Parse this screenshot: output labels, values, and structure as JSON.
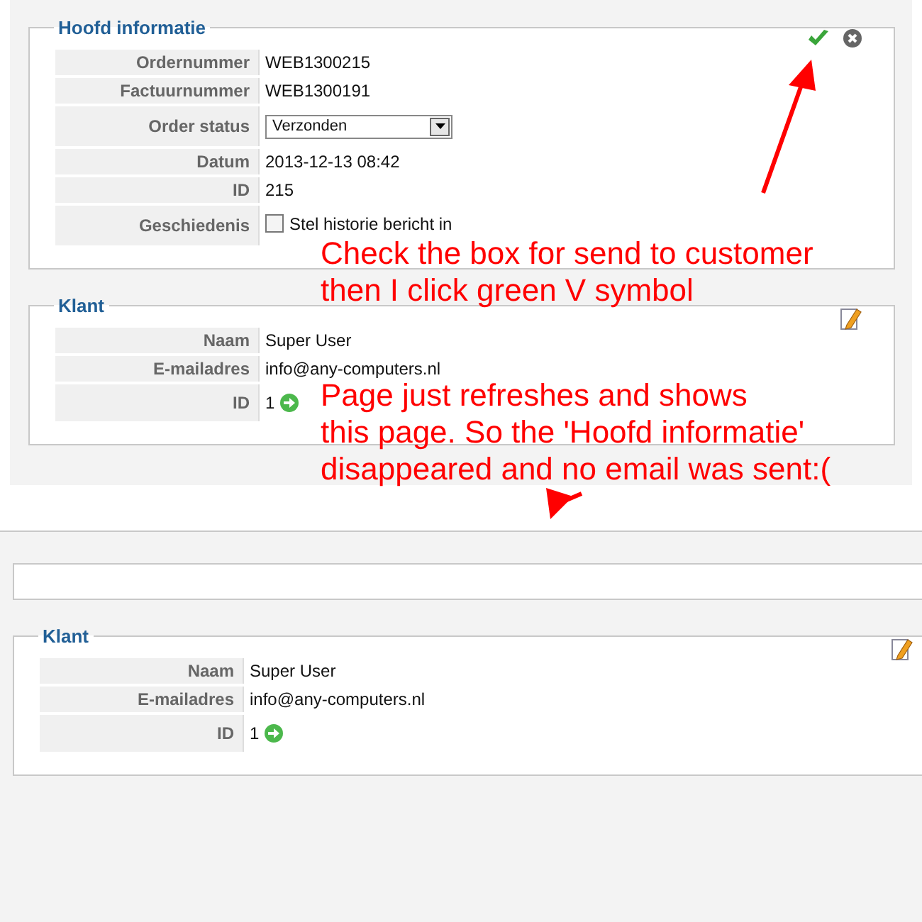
{
  "before": {
    "order_section": {
      "title": "Hoofd informatie",
      "rows": [
        {
          "kind": "text",
          "label": "Ordernummer",
          "value": "WEB1300215"
        },
        {
          "kind": "text",
          "label": "Factuurnummer",
          "value": "WEB1300191"
        },
        {
          "kind": "select",
          "label": "Order status",
          "value": "Verzonden"
        },
        {
          "kind": "text",
          "label": "Datum",
          "value": "2013-12-13 08:42"
        },
        {
          "kind": "text",
          "label": "ID",
          "value": "215"
        },
        {
          "kind": "checkbox",
          "label": "Geschiedenis",
          "option": "Stel historie bericht in",
          "checked": false
        }
      ]
    },
    "customer_section": {
      "title": "Klant",
      "rows": [
        {
          "kind": "text",
          "label": "Naam",
          "value": "Super User"
        },
        {
          "kind": "text",
          "label": "E-mailadres",
          "value": "info@any-computers.nl"
        },
        {
          "kind": "link",
          "label": "ID",
          "value": "1"
        }
      ]
    }
  },
  "after": {
    "customer_section": {
      "title": "Klant",
      "rows": [
        {
          "kind": "text",
          "label": "Naam",
          "value": "Super User"
        },
        {
          "kind": "text",
          "label": "E-mailadres",
          "value": "info@any-computers.nl"
        },
        {
          "kind": "link",
          "label": "ID",
          "value": "1"
        }
      ]
    }
  },
  "annotations": [
    {
      "lines": [
        "Check the box for send to customer",
        "then I click green V symbol"
      ]
    },
    {
      "lines": [
        "Page just refreshes and shows",
        "this page. So the  'Hoofd informatie'",
        "disappeared and no email was sent:("
      ]
    }
  ]
}
